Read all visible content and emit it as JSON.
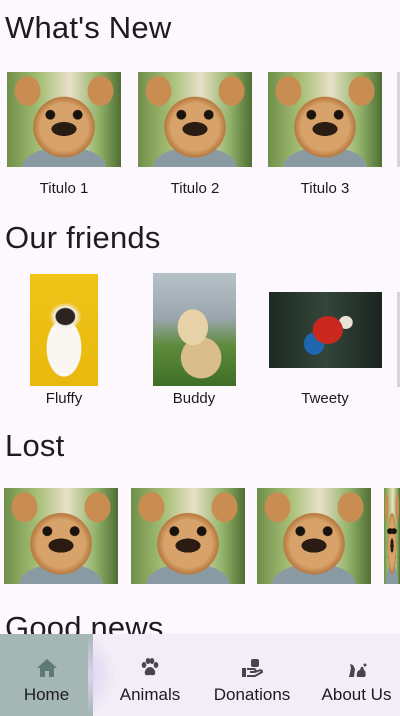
{
  "sections": {
    "whats_new": {
      "title": "What's New",
      "items": [
        {
          "caption": "Titulo 1",
          "image": "yorkie-dog-photo"
        },
        {
          "caption": "Titulo 2",
          "image": "yorkie-dog-photo"
        },
        {
          "caption": "Titulo 3",
          "image": "yorkie-dog-photo"
        }
      ]
    },
    "our_friends": {
      "title": "Our friends",
      "items": [
        {
          "caption": "Fluffy",
          "image": "cat-photo"
        },
        {
          "caption": "Buddy",
          "image": "golden-retriever-photo"
        },
        {
          "caption": "Tweety",
          "image": "parrot-photo"
        }
      ]
    },
    "lost": {
      "title": "Lost",
      "items": [
        {
          "image": "yorkie-dog-photo"
        },
        {
          "image": "yorkie-dog-photo"
        },
        {
          "image": "yorkie-dog-photo"
        }
      ]
    },
    "good_news": {
      "title": "Good news"
    }
  },
  "bottom_nav": {
    "selected": "Home",
    "items": [
      {
        "label": "Home",
        "icon": "home-icon"
      },
      {
        "label": "Animals",
        "icon": "paw-icon"
      },
      {
        "label": "Donations",
        "icon": "donation-hand-icon"
      },
      {
        "label": "About Us",
        "icon": "pets-group-icon"
      }
    ]
  },
  "colors": {
    "background": "#fdf8fd",
    "nav_background": "#f3edf7",
    "selected_nav": "#a4b7b5"
  }
}
